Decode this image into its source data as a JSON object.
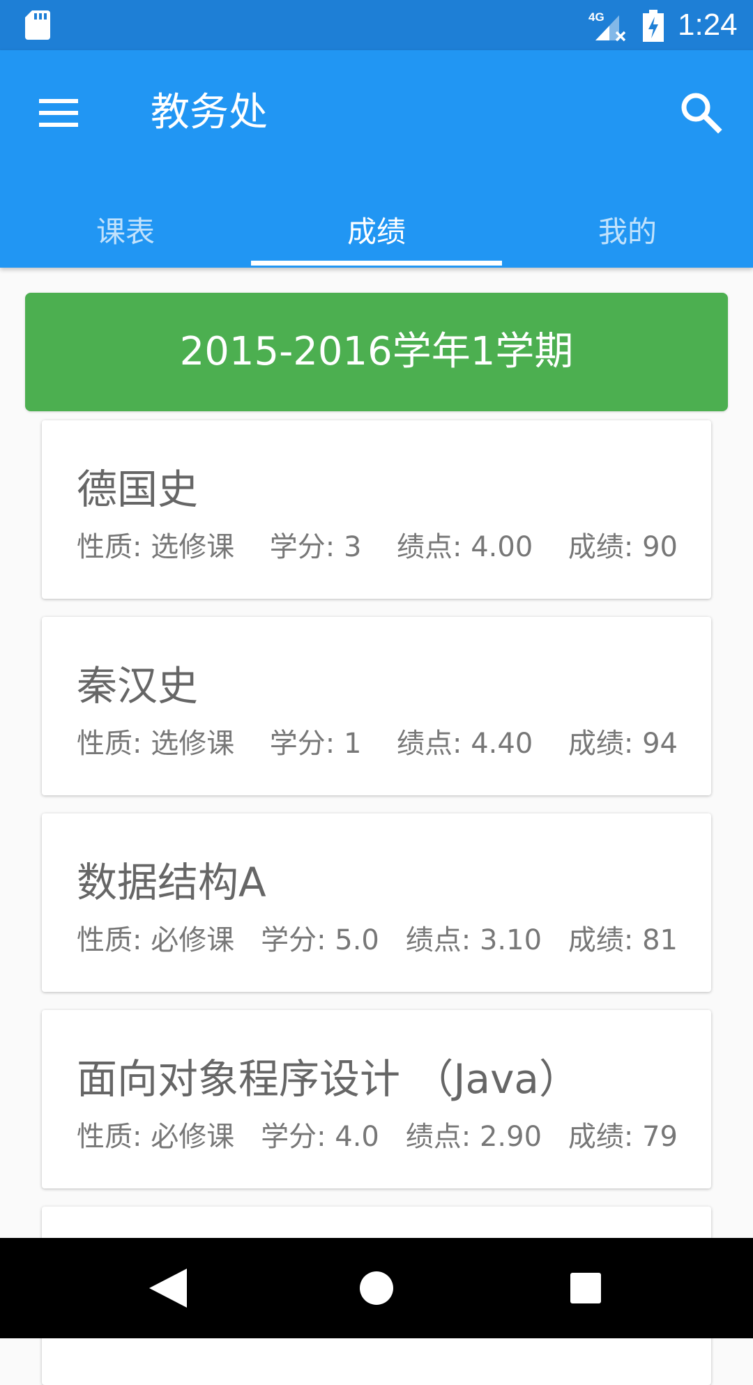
{
  "status_bar": {
    "time": "1:24",
    "network": "4G",
    "icons": [
      "sd-card-icon",
      "signal-4g-icon",
      "battery-charging-icon"
    ]
  },
  "app_bar": {
    "title": "教务处",
    "menu_icon": "menu-icon",
    "search_icon": "search-icon",
    "tabs": [
      {
        "label": "课表",
        "active": false
      },
      {
        "label": "成绩",
        "active": true
      },
      {
        "label": "我的",
        "active": false
      }
    ]
  },
  "semester": {
    "title": "2015-2016学年1学期"
  },
  "courses": [
    {
      "name": "德国史",
      "type": "性质: 选修课",
      "credit": "学分: 3",
      "gpa": "绩点: 4.00",
      "score": "成绩: 90"
    },
    {
      "name": "秦汉史",
      "type": "性质: 选修课",
      "credit": "学分: 1",
      "gpa": "绩点: 4.40",
      "score": "成绩: 94"
    },
    {
      "name": "数据结构A",
      "type": "性质: 必修课",
      "credit": "学分: 5.0",
      "gpa": "绩点: 3.10",
      "score": "成绩: 81"
    },
    {
      "name": "面向对象程序设计 （Java）",
      "type": "性质: 必修课",
      "credit": "学分: 4.0",
      "gpa": "绩点: 2.90",
      "score": "成绩: 79"
    }
  ],
  "nav_bar": {
    "icons": [
      "back-icon",
      "home-icon",
      "recents-icon"
    ]
  },
  "colors": {
    "status_bar": "#1e7fd6",
    "primary": "#2196f3",
    "semester_header": "#4caf50",
    "background": "#fafafa",
    "card": "#ffffff",
    "text_secondary": "#666666"
  }
}
